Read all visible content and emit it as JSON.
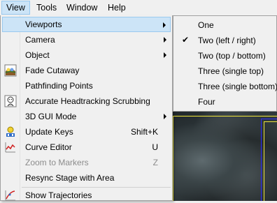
{
  "menubar": {
    "items": [
      {
        "label": "View",
        "active": true
      },
      {
        "label": "Tools"
      },
      {
        "label": "Window"
      },
      {
        "label": "Help"
      }
    ]
  },
  "view_menu": {
    "items": [
      {
        "label": "Viewports",
        "submenu": true,
        "highlighted": true
      },
      {
        "label": "Camera",
        "submenu": true
      },
      {
        "label": "Object",
        "submenu": true
      },
      {
        "label": "Fade Cutaway",
        "icon": "fade-cutaway-icon"
      },
      {
        "label": "Pathfinding Points"
      },
      {
        "label": "Accurate Headtracking Scrubbing",
        "icon": "headtracking-icon"
      },
      {
        "label": "3D GUI Mode",
        "submenu": true
      },
      {
        "label": "Update Keys",
        "shortcut": "Shift+K",
        "icon": "update-keys-icon"
      },
      {
        "label": "Curve Editor",
        "shortcut": "U",
        "icon": "curve-editor-icon"
      },
      {
        "label": "Zoom to Markers",
        "shortcut": "Z",
        "disabled": true
      },
      {
        "label": "Resync Stage with Area"
      },
      {
        "label": "Show Trajectories",
        "icon": "trajectories-icon"
      }
    ]
  },
  "viewports_submenu": {
    "items": [
      {
        "label": "One"
      },
      {
        "label": "Two (left / right)",
        "checked": true
      },
      {
        "label": "Two (top / bottom)"
      },
      {
        "label": "Three (single top)"
      },
      {
        "label": "Three (single bottom)"
      },
      {
        "label": "Four"
      }
    ],
    "check_glyph": "✔"
  }
}
